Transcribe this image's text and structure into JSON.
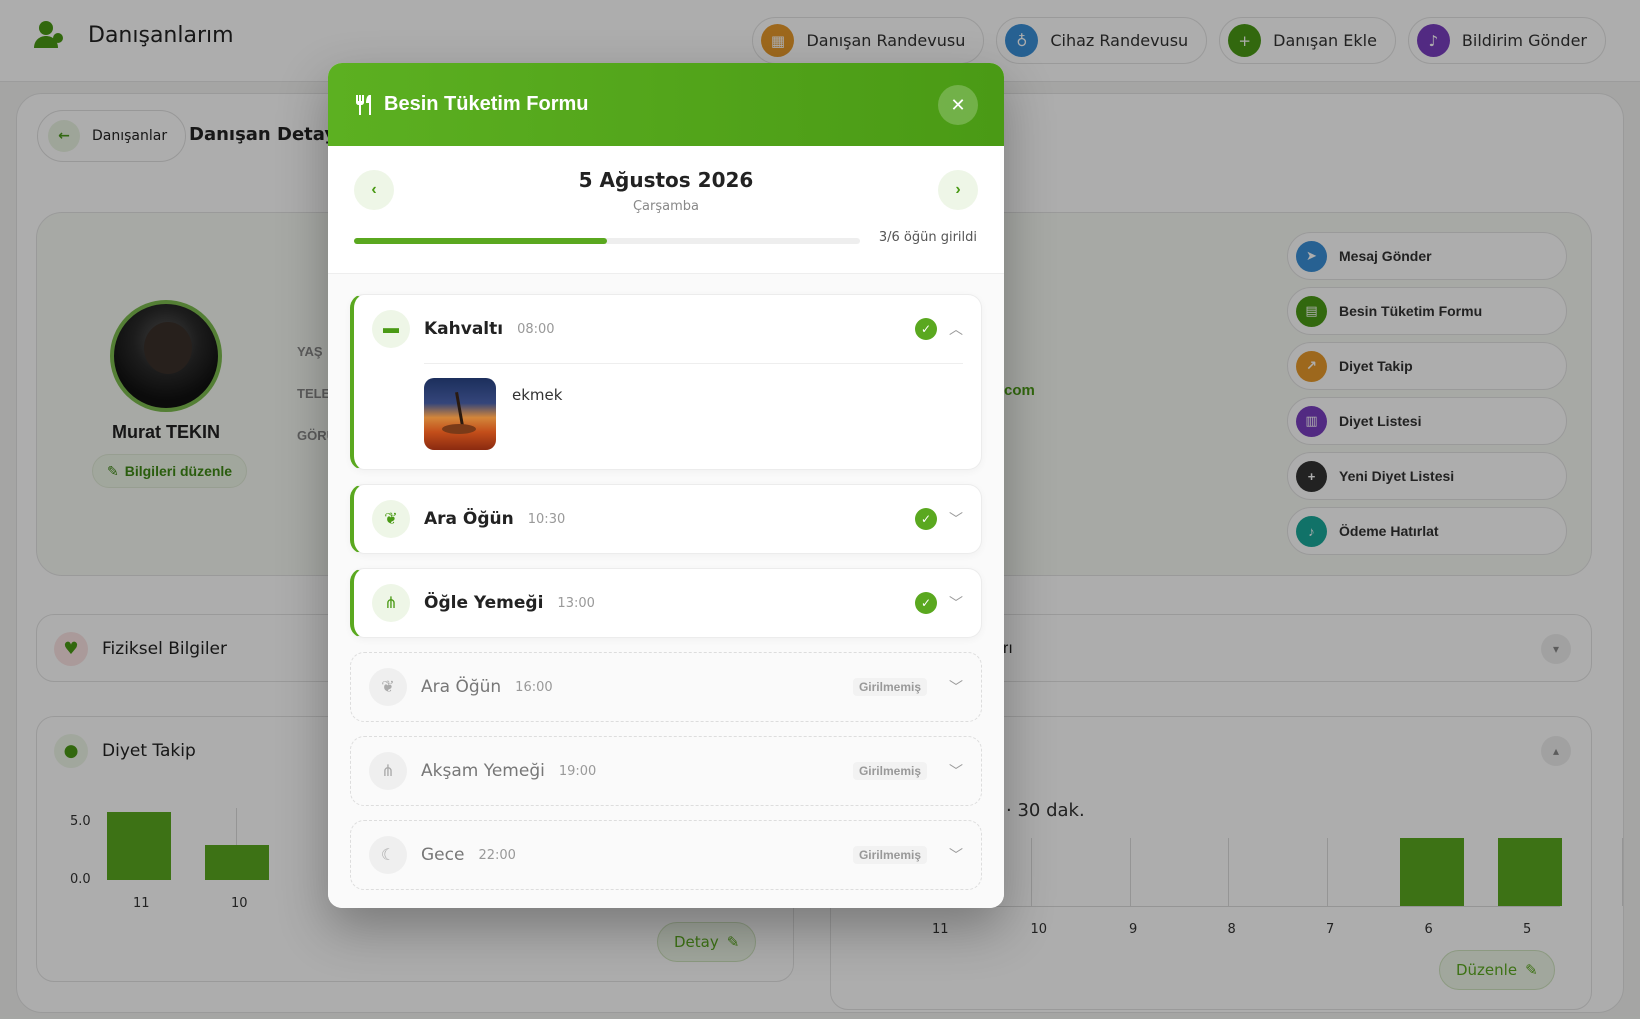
{
  "header": {
    "title": "Danışanlarım",
    "nav": [
      {
        "label": "Danışan Randevusu",
        "color": "#e89a2c",
        "icon": "calendar-icon"
      },
      {
        "label": "Cihaz Randevusu",
        "color": "#3a8fd8",
        "icon": "stethoscope-icon"
      },
      {
        "label": "Danışan Ekle",
        "color": "#4a9a15",
        "icon": "user-plus-icon"
      },
      {
        "label": "Bildirim Gönder",
        "color": "#7a3fc0",
        "icon": "bell-icon"
      }
    ]
  },
  "breadcrumb": {
    "back_label": "Danışanlar",
    "page_title": "Danışan Detayı"
  },
  "client": {
    "name": "Murat TEKIN",
    "edit_label": "Bilgileri düzenle",
    "field_labels": [
      "YAŞ",
      "TELE",
      "GÖRÜ"
    ],
    "email_fragment": "com"
  },
  "actions": [
    {
      "label": "Mesaj Gönder",
      "color": "#3a8fd8",
      "icon": "send-icon"
    },
    {
      "label": "Besin Tüketim Formu",
      "color": "#4a9a15",
      "icon": "book-icon"
    },
    {
      "label": "Diyet Takip",
      "color": "#e89a2c",
      "icon": "chart-icon"
    },
    {
      "label": "Diyet Listesi",
      "color": "#7a3fc0",
      "icon": "list-icon"
    },
    {
      "label": "Yeni Diyet Listesi",
      "color": "#333333",
      "icon": "plus-icon"
    },
    {
      "label": "Ödeme Hatırlat",
      "color": "#1aa89a",
      "icon": "bell-icon"
    }
  ],
  "sections": {
    "physical": "Fiziksel Bilgiler",
    "physical_right_fragment": "rı",
    "diet": "Diyet Takip",
    "activity_fragment": "· 30 dak.",
    "detail_btn": "Detay",
    "edit_btn": "Düzenle"
  },
  "chart_data": [
    {
      "type": "bar",
      "categories": [
        "11",
        "10"
      ],
      "values": [
        5.9,
        3.0
      ],
      "yticks": [
        "5.0",
        "0.0"
      ]
    },
    {
      "type": "bar",
      "categories": [
        "11",
        "10",
        "9",
        "8",
        "7",
        "6",
        "5"
      ],
      "values": [
        0,
        0,
        0,
        0,
        0,
        30,
        30
      ]
    }
  ],
  "modal": {
    "title": "Besin Tüketim Formu",
    "date": "5 Ağustos 2026",
    "day": "Çarşamba",
    "progress_text": "3/6 öğün girildi",
    "progress_fraction": 0.5,
    "empty_label": "Girilmemiş",
    "meals": [
      {
        "name": "Kahvaltı",
        "time": "08:00",
        "status": "done",
        "expanded": true,
        "icon": "coffee-icon",
        "food": "ekmek"
      },
      {
        "name": "Ara Öğün",
        "time": "10:30",
        "status": "done",
        "expanded": false,
        "icon": "leaf-icon"
      },
      {
        "name": "Öğle Yemeği",
        "time": "13:00",
        "status": "done",
        "expanded": false,
        "icon": "utensils-icon"
      },
      {
        "name": "Ara Öğün",
        "time": "16:00",
        "status": "empty",
        "expanded": false,
        "icon": "leaf-icon"
      },
      {
        "name": "Akşam Yemeği",
        "time": "19:00",
        "status": "empty",
        "expanded": false,
        "icon": "utensils-icon"
      },
      {
        "name": "Gece",
        "time": "22:00",
        "status": "empty",
        "expanded": false,
        "icon": "moon-icon"
      }
    ]
  }
}
